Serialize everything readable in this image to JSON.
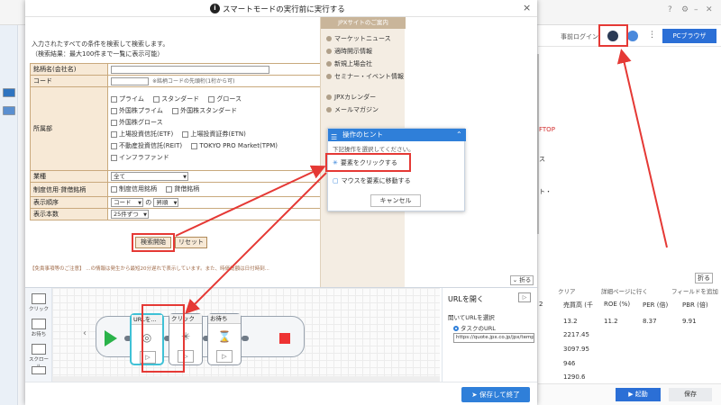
{
  "modal": {
    "title": "スマートモードの実行前に実行する",
    "close": "×"
  },
  "web": {
    "intro": "入力されたすべての条件を検索して検索します。",
    "limit": "（検索結果：最大100件まで一覧に表示可能）",
    "form": {
      "company_label": "銘柄名(会社名)",
      "code_label": "コード",
      "code_hint": "※銘柄コードの先頭桁(1桁から可)",
      "market_label": "所属部",
      "markets": [
        "プライム",
        "スタンダード",
        "グロース",
        "外国株プライム",
        "外国株スタンダード",
        "外国株グロース",
        "上場投資信託(ETF)",
        "上場投資証券(ETN)",
        "不動産投資信託(REIT)",
        "TOKYO PRO Market(TPM)",
        "インフラファンド"
      ],
      "industry_label": "業種",
      "industry_value": "全て",
      "margin_label": "制度信用·貸借銘柄",
      "margin_opts": [
        "制度信用銘柄",
        "貸借銘柄"
      ],
      "order_label": "表示順序",
      "order_field": "コード",
      "order_of": "の",
      "order_dir": "昇順",
      "count_label": "表示本数",
      "count_value": "25件ずつ"
    },
    "search_button": "検索開始",
    "reset_button": "リセット",
    "disclaimer": "【免責事項等のご注意】 ...の情報は発生から最短20分遅れで表示しています。また、時価総額は日付時刻...",
    "side_title": "JPXサイトのご案内",
    "side_items": [
      "マーケットニュース",
      "適時開示情報",
      "新規上場会社",
      "セミナー・イベント情報",
      "JPXカレンダー",
      "メールマガジン"
    ],
    "fold": "折る"
  },
  "tips": {
    "title": "操作のヒント",
    "subtitle": "下記操作を選択してください。",
    "item1": "要素をクリックする",
    "item2": "マウスを要素に移動する",
    "cancel": "キャンセル"
  },
  "editor": {
    "palette": [
      "クリック",
      "お待ち",
      "スクロール"
    ],
    "blocks": [
      "URLを...",
      "クリック",
      "お待ち"
    ],
    "url_pane_title": "URLを開く",
    "url_pane_sub": "開いてURLを選択",
    "url_radio": "タスクのURL",
    "url_value": "https://quote.jpx.co.jp/jpx/template/qu",
    "save_close": "保存して終了"
  },
  "bg": {
    "login": "事前ログイン",
    "pc_browser": "PCブラウザ",
    "snip1": "FTOP",
    "snip2": "ス",
    "snip3": "ト・",
    "clear": "クリア",
    "detail": "詳細ページに行く",
    "field_add": "フィールドを追加",
    "col1": "2",
    "col2": "売買高 (千",
    "col3": "ROE (%)",
    "col4": "PER (倍)",
    "col5": "PBR (倍)",
    "r1": [
      "13.2",
      "11.2",
      "8.37",
      "9.91"
    ],
    "r2": "2217.45",
    "r3": "3097.95",
    "r4": "946",
    "r5": "1290.6",
    "run": "起動",
    "save": "保存",
    "fold": "折る"
  },
  "colors": {
    "accent": "#2f7fd9",
    "annotation": "#e53935",
    "form_label_bg": "#f7e9d6",
    "start": "#2ab34a",
    "stop": "#e33333"
  }
}
